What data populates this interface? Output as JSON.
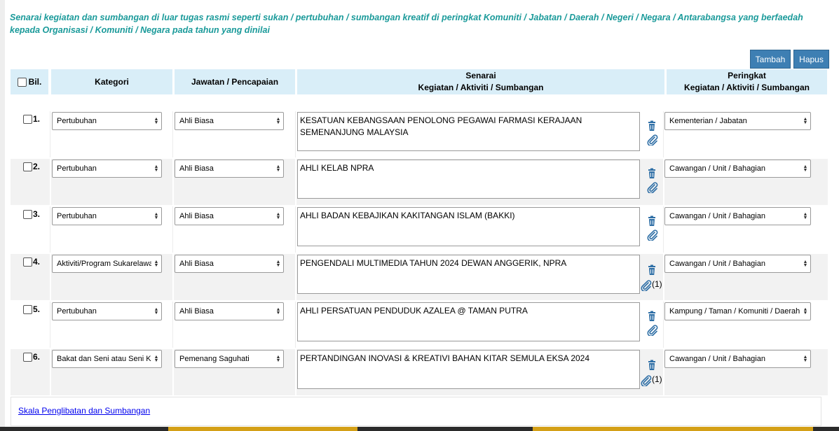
{
  "intro_text": "Senarai kegiatan dan sumbangan di luar tugas rasmi seperti sukan / pertubuhan / sumbangan kreatif di peringkat Komuniti / Jabatan / Daerah / Negeri / Negara / Antarabangsa yang berfaedah kepada Organisasi / Komuniti / Negara pada tahun yang dinilai",
  "toolbar": {
    "add_label": "Tambah",
    "delete_label": "Hapus"
  },
  "table": {
    "headers": {
      "bil": "Bil.",
      "kategori": "Kategori",
      "jawatan": "Jawatan / Pencapaian",
      "senarai_line1": "Senarai",
      "senarai_line2": "Kegiatan / Aktiviti / Sumbangan",
      "peringkat_line1": "Peringkat",
      "peringkat_line2": "Kegiatan / Aktiviti / Sumbangan"
    },
    "rows": [
      {
        "num": "1.",
        "kategori": "Pertubuhan",
        "jawatan": "Ahli Biasa",
        "senarai": "KESATUAN KEBANGSAAN PENOLONG PEGAWAI FARMASI KERAJAAN SEMENANJUNG MALAYSIA",
        "peringkat": "Kementerian / Jabatan",
        "attachment_count": ""
      },
      {
        "num": "2.",
        "kategori": "Pertubuhan",
        "jawatan": "Ahli Biasa",
        "senarai": "AHLI KELAB NPRA",
        "peringkat": "Cawangan / Unit / Bahagian",
        "attachment_count": ""
      },
      {
        "num": "3.",
        "kategori": "Pertubuhan",
        "jawatan": "Ahli Biasa",
        "senarai": "AHLI BADAN KEBAJIKAN KAKITANGAN ISLAM (BAKKI)",
        "peringkat": "Cawangan / Unit / Bahagian",
        "attachment_count": ""
      },
      {
        "num": "4.",
        "kategori": "Aktiviti/Program Sukarelawan",
        "jawatan": "Ahli Biasa",
        "senarai": "PENGENDALI MULTIMEDIA TAHUN 2024 DEWAN ANGGERIK, NPRA",
        "peringkat": "Cawangan / Unit / Bahagian",
        "attachment_count": "(1)"
      },
      {
        "num": "5.",
        "kategori": "Pertubuhan",
        "jawatan": "Ahli Biasa",
        "senarai": "AHLI PERSATUAN PENDUDUK AZALEA @ TAMAN PUTRA",
        "peringkat": "Kampung / Taman / Komuniti / Daerah",
        "attachment_count": ""
      },
      {
        "num": "6.",
        "kategori": "Bakat dan Seni atau Seni Kreatif",
        "jawatan": "Pemenang Saguhati",
        "senarai": "PERTANDINGAN INOVASI & KREATIVI BAHAN KITAR SEMULA EKSA 2024",
        "peringkat": "Cawangan / Unit / Bahagian",
        "attachment_count": "(1)"
      }
    ]
  },
  "footer_link": "Skala Penglibatan dan Sumbangan",
  "colors": {
    "intro": "#1a9a9a",
    "button": "#3e7fb3",
    "header_bg": "#d9eef8",
    "icon": "#2f6fa6"
  },
  "icons": {
    "delete": "trash-icon",
    "attach": "paperclip-icon",
    "select": "updown-arrow-icon"
  }
}
